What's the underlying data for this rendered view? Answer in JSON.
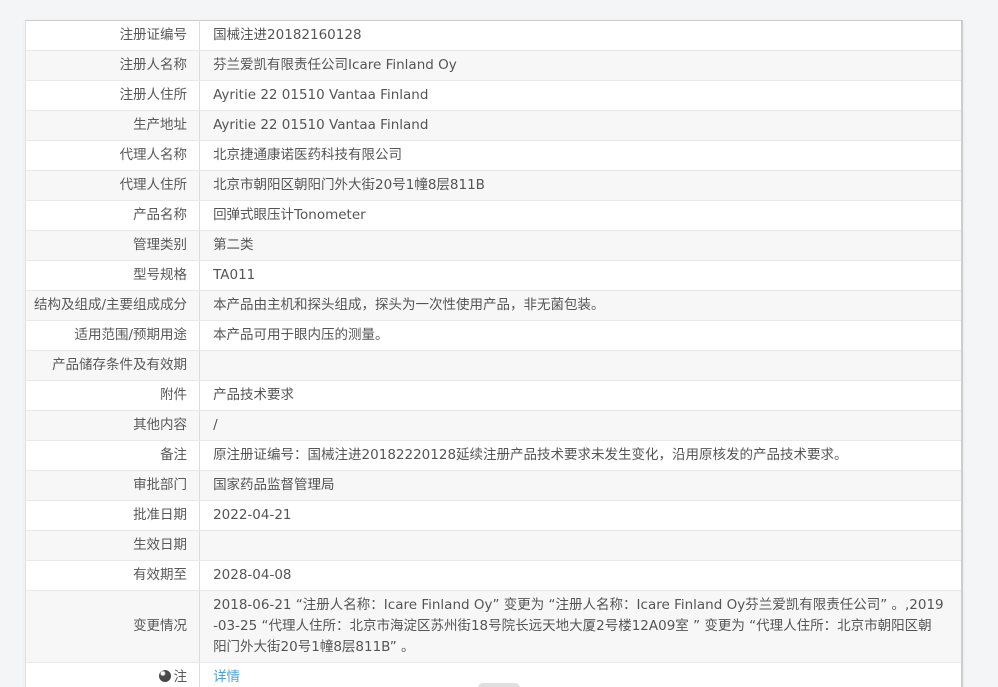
{
  "colors": {
    "page_background": "#f4f5f7",
    "row_stripe": "#f7f7f7",
    "border": "#e9e9e9",
    "divider": "#dcdcdc",
    "text": "#555555",
    "link": "#4a9fe0"
  },
  "icons": {
    "note": "bulb-icon"
  },
  "table": {
    "rows": [
      {
        "label": "注册证编号",
        "value": "国械注进20182160128"
      },
      {
        "label": "注册人名称",
        "value": "芬兰爱凯有限责任公司Icare Finland Oy"
      },
      {
        "label": "注册人住所",
        "value": "Ayritie 22 01510 Vantaa Finland"
      },
      {
        "label": "生产地址",
        "value": "Ayritie 22 01510 Vantaa Finland"
      },
      {
        "label": "代理人名称",
        "value": "北京捷通康诺医药科技有限公司"
      },
      {
        "label": "代理人住所",
        "value": "北京市朝阳区朝阳门外大街20号1幢8层811B"
      },
      {
        "label": "产品名称",
        "value": "回弹式眼压计Tonometer"
      },
      {
        "label": "管理类别",
        "value": "第二类"
      },
      {
        "label": "型号规格",
        "value": "TA011"
      },
      {
        "label": "结构及组成/主要组成成分",
        "value": "本产品由主机和探头组成，探头为一次性使用产品，非无菌包装。"
      },
      {
        "label": "适用范围/预期用途",
        "value": "本产品可用于眼内压的测量。"
      },
      {
        "label": "产品储存条件及有效期",
        "value": ""
      },
      {
        "label": "附件",
        "value": "产品技术要求"
      },
      {
        "label": "其他内容",
        "value": "/"
      },
      {
        "label": "备注",
        "value": "原注册证编号：国械注进20182220128延续注册产品技术要求未发生变化，沿用原核发的产品技术要求。"
      },
      {
        "label": "审批部门",
        "value": "国家药品监督管理局"
      },
      {
        "label": "批准日期",
        "value": "2022-04-21"
      },
      {
        "label": "生效日期",
        "value": ""
      },
      {
        "label": "有效期至",
        "value": "2028-04-08"
      },
      {
        "label": "变更情况",
        "value": "2018-06-21 “注册人名称：Icare Finland Oy” 变更为 “注册人名称：Icare Finland Oy芬兰爱凯有限责任公司” 。,2019-03-25 “代理人住所：北京市海淀区苏州街18号院长远天地大厦2号楼12A09室 ” 变更为 “代理人住所：北京市朝阳区朝阳门外大街20号1幢8层811B” 。"
      },
      {
        "label": "注",
        "value": "详情"
      }
    ]
  }
}
